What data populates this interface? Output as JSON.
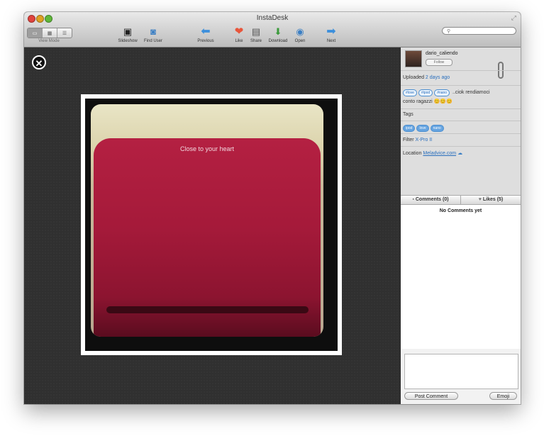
{
  "window": {
    "title": "InstaDesk"
  },
  "toolbar": {
    "view_mode_label": "View Mode",
    "buttons": [
      {
        "label": "Slideshow",
        "icon": "slideshow-icon"
      },
      {
        "label": "Find User",
        "icon": "find-user-icon"
      },
      {
        "label": "Previous",
        "icon": "previous-arrow-icon"
      },
      {
        "label": "Like",
        "icon": "heart-icon"
      },
      {
        "label": "Share",
        "icon": "share-icon"
      },
      {
        "label": "Download",
        "icon": "download-icon"
      },
      {
        "label": "Open",
        "icon": "open-icon"
      },
      {
        "label": "Next",
        "icon": "next-arrow-icon"
      }
    ]
  },
  "photo": {
    "caption_text": "Close to your heart"
  },
  "sidebar": {
    "username": "dario_caliendo",
    "follow_label": "Follow",
    "uploaded_label": "Uploaded",
    "uploaded_time": "2 days ago",
    "caption_tags": [
      "#love",
      "#ipod",
      "#nano"
    ],
    "caption_text": "..ciok rendiamoci",
    "caption_text_2": "conto ragazzi",
    "caption_emoji": "😊😊😊",
    "tags_label": "Tags",
    "tags": [
      "ipod",
      "love",
      "nano"
    ],
    "filter_label": "Filter",
    "filter_value": "X-Pro II",
    "location_label": "Location",
    "location_value": "Meladvice.com",
    "comments_tab": "Comments (0)",
    "likes_tab": "Likes (5)",
    "no_comments": "No Comments yet",
    "post_comment": "Post Comment",
    "emoji": "Emoji"
  },
  "colors": {
    "accent": "#2a6fbd",
    "like": "#e8553a",
    "arrow": "#3b8fdc"
  }
}
